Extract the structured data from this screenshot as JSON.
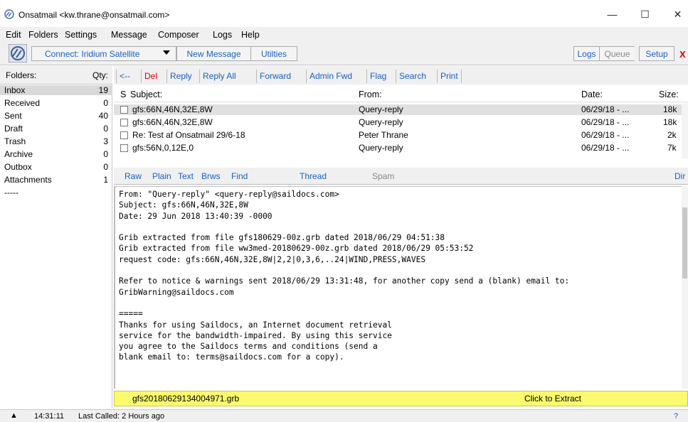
{
  "window": {
    "title": "Onsatmail <kw.thrane@onsatmail.com>",
    "minimize_icon": "minimize-icon",
    "maximize_icon": "maximize-icon",
    "close_icon": "close-icon",
    "minimize_glyph": "—",
    "maximize_glyph": "☐",
    "close_glyph": "✕"
  },
  "menu": [
    "Edit",
    "Folders",
    "Settings",
    "Message",
    "Composer",
    "Logs",
    "Help"
  ],
  "toolbar": {
    "connect_label": "Connect: Iridium Satellite",
    "new_message": "New Message",
    "utilities": "Utilties",
    "logs": "Logs",
    "queue": "Queue",
    "setup": "Setup",
    "close_x": "X"
  },
  "folders": {
    "header_name": "Folders:",
    "header_qty": "Qty:",
    "items": [
      {
        "name": "Inbox",
        "qty": "19"
      },
      {
        "name": "Received",
        "qty": "0"
      },
      {
        "name": "Sent",
        "qty": "40"
      },
      {
        "name": "Draft",
        "qty": "0"
      },
      {
        "name": "Trash",
        "qty": "3"
      },
      {
        "name": "Archive",
        "qty": "0"
      },
      {
        "name": "Outbox",
        "qty": "0"
      },
      {
        "name": "Attachments",
        "qty": "1"
      },
      {
        "name": "-----",
        "qty": ""
      }
    ]
  },
  "msgbar": {
    "back": "<--",
    "del": "Del",
    "reply": "Reply",
    "reply_all": "Reply All",
    "forward": "Forward",
    "admin_fwd": "Admin Fwd",
    "flag": "Flag",
    "search": "Search",
    "print": "Print"
  },
  "list": {
    "headers": {
      "s": "S",
      "subject": "Subject:",
      "from": "From:",
      "date": "Date:",
      "size": "Size:"
    },
    "rows": [
      {
        "subject": "gfs:66N,46N,32E,8W",
        "from": "Query-reply",
        "date": "06/29/18 - ...",
        "size": "18k"
      },
      {
        "subject": "gfs:66N,46N,32E,8W",
        "from": "Query-reply",
        "date": "06/29/18 - ...",
        "size": "18k"
      },
      {
        "subject": "Re: Test af Onsatmail 29/6-18",
        "from": "Peter Thrane",
        "date": "06/29/18 - ...",
        "size": "2k"
      },
      {
        "subject": "gfs:56N,0,12E,0",
        "from": "Query-reply",
        "date": "06/29/18 - ...",
        "size": "7k"
      }
    ]
  },
  "tabs": {
    "raw": "Raw",
    "plain": "Plain",
    "text": "Text",
    "brws": "Brws",
    "find": "Find",
    "thread": "Thread",
    "spam": "Spam",
    "dir": "Dir"
  },
  "body": {
    "text": "From: \"Query-reply\" <query-reply@saildocs.com>\nSubject: gfs:66N,46N,32E,8W\nDate: 29 Jun 2018 13:40:39 -0000\n\nGrib extracted from file gfs180629-00z.grb dated 2018/06/29 04:51:38\nGrib extracted from file ww3med-20180629-00z.grb dated 2018/06/29 05:53:52\nrequest code: gfs:66N,46N,32E,8W|2,2|0,3,6,..24|WIND,PRESS,WAVES\n\nRefer to notice & warnings sent 2018/06/29 13:31:48, for another copy send a (blank) email to:\nGribWarning@saildocs.com\n\n=====\nThanks for using Saildocs, an Internet document retrieval\nservice for the bandwidth-impaired. By using this service\nyou agree to the Saildocs terms and conditions (send a\nblank email to: terms@saildocs.com for a copy)."
  },
  "attachment": {
    "filename": "gfs20180629134004971.grb",
    "action": "Click to Extract"
  },
  "status": {
    "up_glyph": "▲",
    "time": "14:31:11",
    "last_called": "Last Called: 2 Hours ago",
    "help": "?"
  },
  "colors": {
    "link_blue": "#1a5ec4",
    "delete_red": "#d00000",
    "attachment_bg": "#fafa6e"
  }
}
